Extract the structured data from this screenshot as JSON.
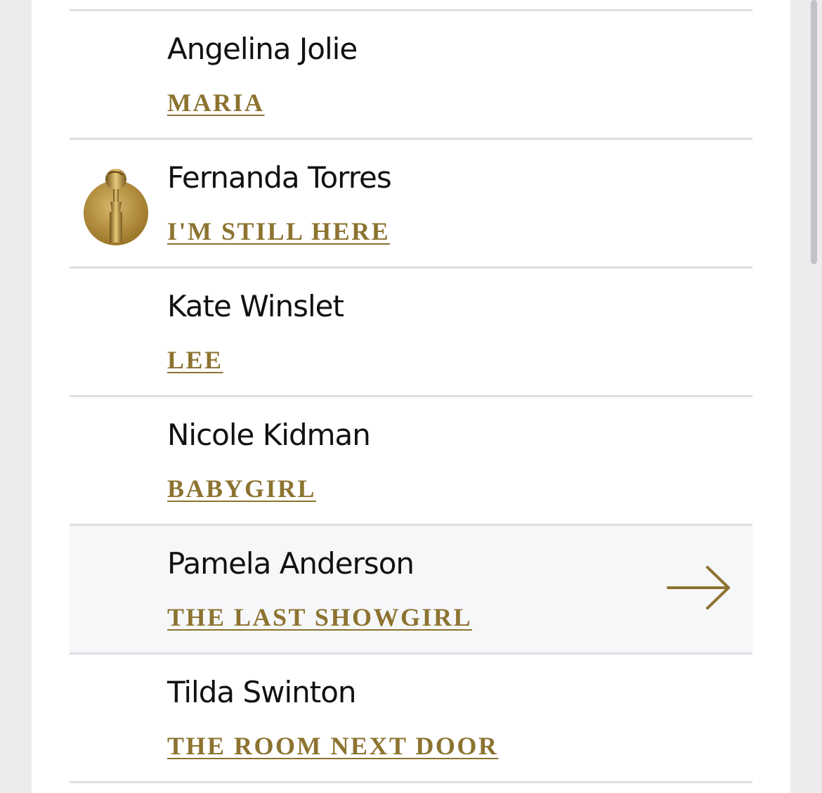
{
  "nominees": [
    {
      "name": "Angelina Jolie",
      "film": "MARIA"
    },
    {
      "name": "Fernanda Torres",
      "film": "I'M STILL HERE"
    },
    {
      "name": "Kate Winslet",
      "film": "LEE"
    },
    {
      "name": "Nicole Kidman",
      "film": "BABYGIRL"
    },
    {
      "name": "Pamela Anderson",
      "film": "THE LAST SHOWGIRL"
    },
    {
      "name": "Tilda Swinton",
      "film": "THE ROOM NEXT DOOR"
    }
  ],
  "winner_badge_icon": "golden-globe-trophy-icon",
  "row_arrow_icon": "arrow-right-icon",
  "colors": {
    "accent_gold": "#8c7330",
    "name_text": "#111111",
    "divider": "#dedee3",
    "highlight_row": "#f6f7f9"
  }
}
